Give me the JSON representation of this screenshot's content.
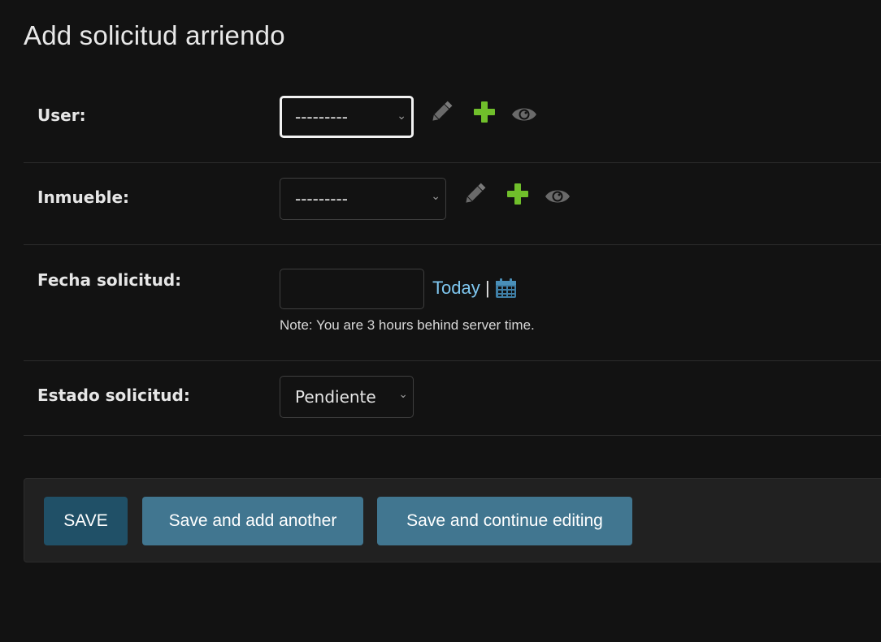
{
  "page": {
    "title": "Add solicitud arriendo"
  },
  "fields": {
    "user": {
      "label": "User:",
      "value": "---------",
      "icons": [
        "pencil-icon",
        "plus-icon",
        "eye-icon"
      ]
    },
    "inmueble": {
      "label": "Inmueble:",
      "value": "---------",
      "icons": [
        "pencil-icon",
        "plus-icon",
        "eye-icon"
      ]
    },
    "fecha": {
      "label": "Fecha solicitud:",
      "value": "",
      "today_label": "Today",
      "separator": "|",
      "note": "Note: You are 3 hours behind server time."
    },
    "estado": {
      "label": "Estado solicitud:",
      "value": "Pendiente"
    }
  },
  "buttons": {
    "save": "SAVE",
    "save_add": "Save and add another",
    "save_continue": "Save and continue editing"
  },
  "colors": {
    "background": "#121212",
    "link": "#7fc7f0",
    "add_icon": "#70bf2b",
    "save_button": "#205067",
    "secondary_button": "#417690"
  }
}
